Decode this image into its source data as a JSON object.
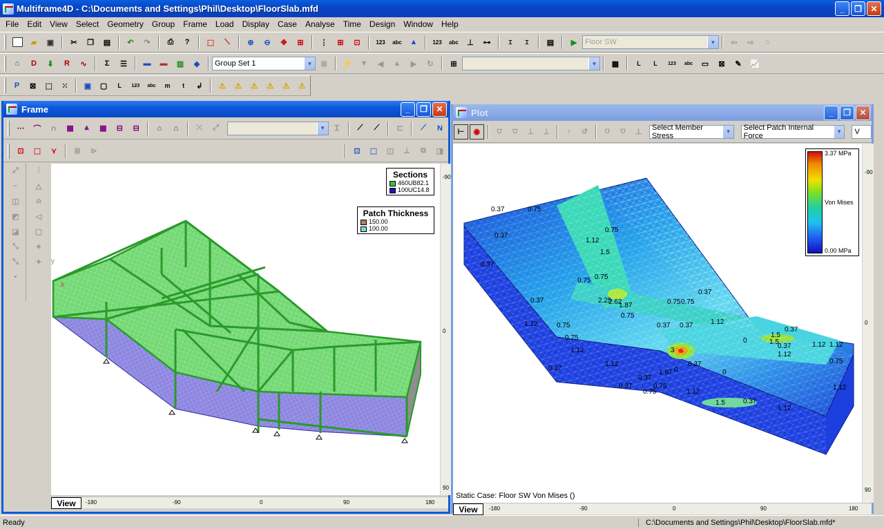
{
  "app": {
    "title": "Multiframe4D - C:\\Documents and Settings\\Phil\\Desktop\\FloorSlab.mfd"
  },
  "menu": [
    "File",
    "Edit",
    "View",
    "Select",
    "Geometry",
    "Group",
    "Frame",
    "Load",
    "Display",
    "Case",
    "Analyse",
    "Time",
    "Design",
    "Window",
    "Help"
  ],
  "toolbar": {
    "load_case": "Floor SW",
    "group_set": "Group Set 1"
  },
  "frame_window": {
    "title": "Frame",
    "view_tab": "View",
    "h_ticks": [
      "-180",
      "-90",
      "0",
      "90",
      "180"
    ],
    "v_ticks": [
      "-90",
      "0",
      "90"
    ],
    "axis_y": "y",
    "axis_x": "x",
    "sections_legend": {
      "title": "Sections",
      "items": [
        {
          "label": "460UB82.1",
          "color": "#3cbf3c"
        },
        {
          "label": "100UC14.8",
          "color": "#1a1ab8"
        }
      ]
    },
    "patch_legend": {
      "title": "Patch Thickness",
      "items": [
        {
          "label": "150.00",
          "color": "#b07a6a"
        },
        {
          "label": "100.00",
          "color": "#7fd4d4"
        }
      ]
    }
  },
  "plot_window": {
    "title": "Plot",
    "view_tab": "View",
    "member_select": "Select Member Stress",
    "patch_select": "Select Patch Internal Force",
    "partial_combo": "V",
    "status": "Static Case: Floor SW  Von Mises ()",
    "h_ticks": [
      "-180",
      "-90",
      "0",
      "90",
      "180"
    ],
    "v_ticks": [
      "-90",
      "0",
      "90"
    ],
    "color_scale": {
      "max": "3.37 MPa",
      "mid": "Von Mises",
      "min": "0.00 MPa"
    },
    "contour_labels": [
      "0.37",
      "0.75",
      "0.37",
      "0.75",
      "1.12",
      "1.5",
      "0.37",
      "0.75",
      "0.75",
      "0.37",
      "2.62",
      "2.25",
      "1.87",
      "0.75",
      "0.75",
      "0.37",
      "0.75",
      "1.12",
      "0.37",
      "1.12",
      "0.37",
      "0.75",
      "1.5",
      "0.37",
      "1.12",
      "3",
      "1.12",
      "0.37",
      "1.87",
      "0.37",
      "0.75",
      "0.75",
      "1.12",
      "1.5",
      "0.37",
      "1.12",
      "1.12",
      "1.12",
      "0.75",
      "1.12",
      "0.37",
      "0.37",
      "1.12",
      "0.75",
      "0.37",
      "0",
      "0",
      "0",
      "1.5"
    ]
  },
  "status": {
    "left": "Ready",
    "right": "C:\\Documents and Settings\\Phil\\Desktop\\FloorSlab.mfd*"
  }
}
